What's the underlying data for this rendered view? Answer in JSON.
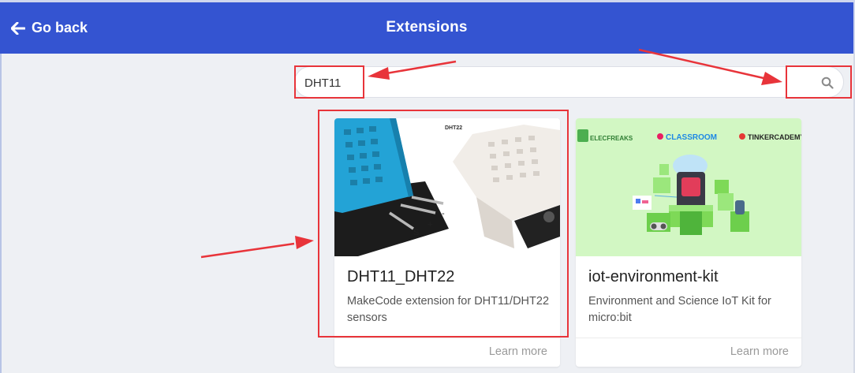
{
  "header": {
    "back_label": "Go back",
    "title": "Extensions",
    "color": "#3454d1"
  },
  "search": {
    "value": "DHT11",
    "icon": "search-icon"
  },
  "cards": [
    {
      "name": "DHT11_DHT22",
      "description": "MakeCode extension for DHT11/DHT22 sensors",
      "image_label": "DHT22",
      "learn_more": "Learn more"
    },
    {
      "name": "iot-environment-kit",
      "description": "Environment and Science IoT Kit for micro:bit",
      "logos": [
        "ELECFREAKS",
        "CLASSROOM",
        "TINKERCADEMY"
      ],
      "learn_more": "Learn more"
    }
  ],
  "annotation_color": "#e8343a"
}
